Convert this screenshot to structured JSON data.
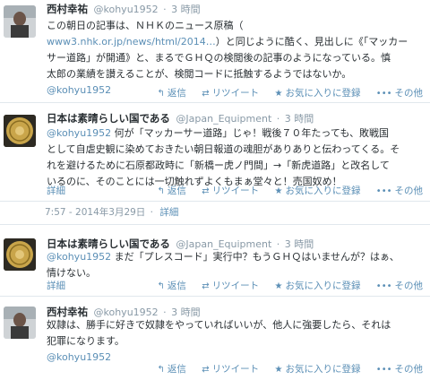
{
  "tweets": [
    {
      "name": "西村幸祐",
      "handle": "@kohyu1952",
      "time": "3 時間",
      "lines": [
        [
          {
            "t": "この朝日の記事は、ＮＨＫのニュース原稿（"
          }
        ],
        [
          {
            "t": "www3.nhk.or.jp/news/html/2014…",
            "link": true
          },
          {
            "t": "）と同じように酷く、見出しに《「マッカー"
          }
        ],
        [
          {
            "t": "サー道路」が開通》と、まるでＧＨＱの検閲後の記事のようになっている。慎"
          }
        ],
        [
          {
            "t": "太郎の業績を讃えることが、検閲コードに抵触するようではないか。"
          }
        ]
      ],
      "mention": "@kohyu1952",
      "actions": {
        "reply": "返信",
        "retweet": "リツイート",
        "favorite": "お気に入りに登録",
        "more": "その他"
      }
    },
    {
      "name": "日本は素晴らしい国である",
      "handle": "@Japan_Equipment",
      "time": "3 時間",
      "lines": [
        [
          {
            "t": "@kohyu1952",
            "link": true
          },
          {
            "t": " 何が「マッカーサー道路」じゃ！戦後７０年たっても、敗戦国"
          }
        ],
        [
          {
            "t": "として自虐史観に染めておきたい朝日報道の魂胆がありありと伝わってくる。そ"
          }
        ],
        [
          {
            "t": "れを避けるために石原都政時に「新橋ー虎ノ門間」→「新虎道路」と改名して"
          }
        ],
        [
          {
            "t": "いるのに、そのことには一切触れずよくもまぁ堂々と！売国奴め！"
          }
        ]
      ],
      "detail": "詳細",
      "actions": {
        "reply": "返信",
        "retweet": "リツイート",
        "favorite": "お気に入りに登録",
        "more": "その他"
      }
    },
    {
      "name": "日本は素晴らしい国である",
      "handle": "@Japan_Equipment",
      "time": "3 時間",
      "lines": [
        [
          {
            "t": "@kohyu1952",
            "link": true
          },
          {
            "t": " まだ「プレスコード」実行中？もうＧＨＱはいませんが？はぁ、"
          }
        ],
        [
          {
            "t": "情けない。"
          }
        ]
      ],
      "detail": "詳細",
      "actions": {
        "reply": "返信",
        "retweet": "リツイート",
        "favorite": "お気に入りに登録",
        "more": "その他"
      }
    },
    {
      "name": "西村幸祐",
      "handle": "@kohyu1952",
      "time": "3 時間",
      "lines": [
        [
          {
            "t": "奴隷は、勝手に好きで奴隷をやっていればいいが、他人に強要したら、それは"
          }
        ],
        [
          {
            "t": "犯罪になります。"
          }
        ]
      ],
      "mention": "@kohyu1952",
      "actions": {
        "reply": "返信",
        "retweet": "リツイート",
        "favorite": "お気に入りに登録",
        "more": "その他"
      }
    }
  ],
  "meta": {
    "timestamp": "7:57 - 2014年3月29日",
    "separator": "·",
    "detail_label": "詳細"
  }
}
